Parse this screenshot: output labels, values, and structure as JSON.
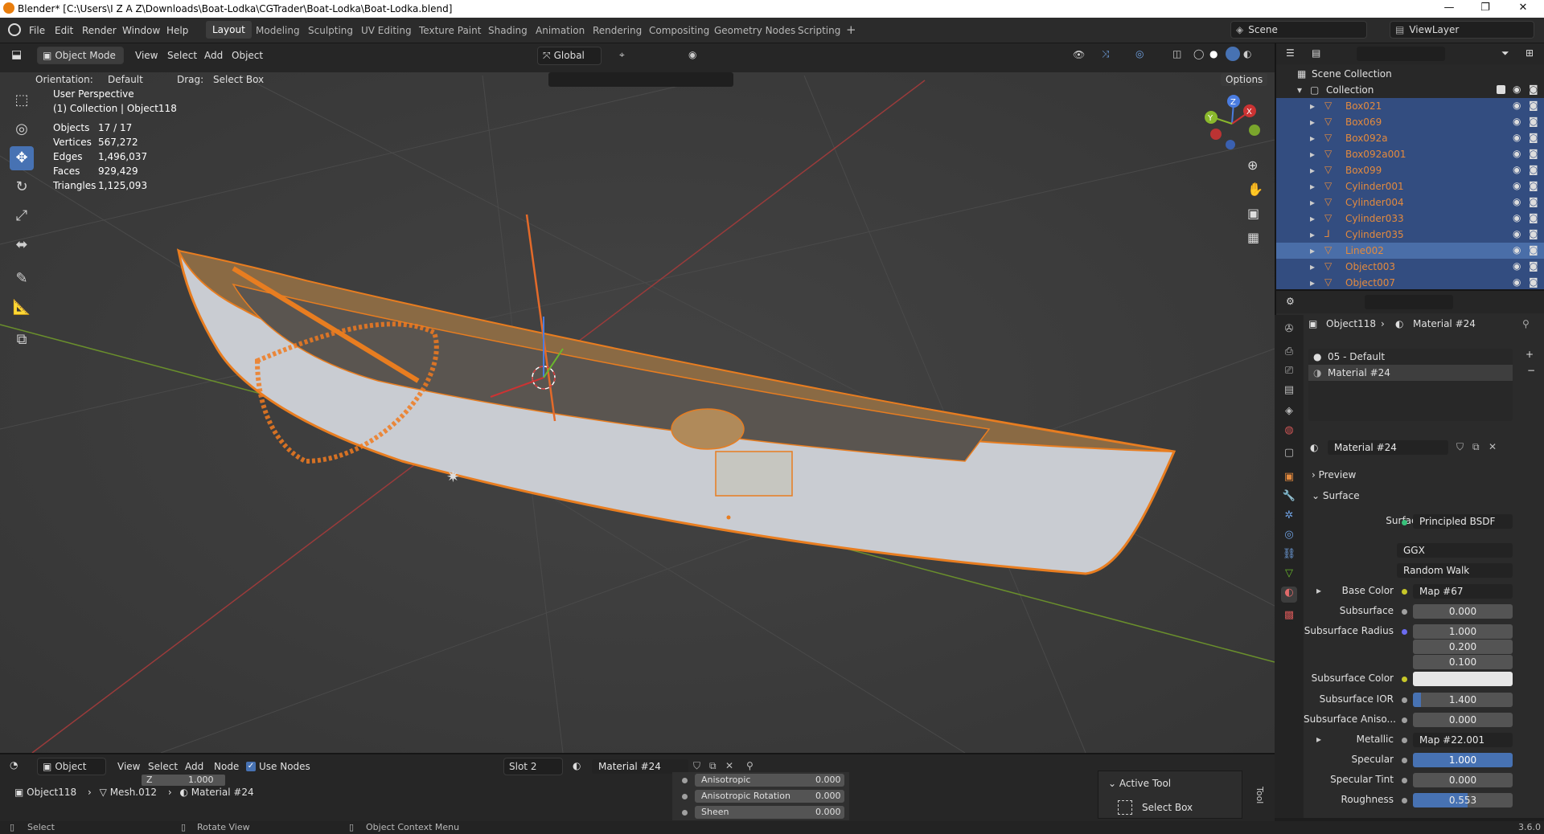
{
  "window": {
    "title": "Blender* [C:\\Users\\I Z A Z\\Downloads\\Boat-Lodka\\CGTrader\\Boat-Lodka\\Boat-Lodka.blend]",
    "minimize": "—",
    "maximize": "❐",
    "close": "✕"
  },
  "menubar": {
    "menus": [
      "File",
      "Edit",
      "Render",
      "Window",
      "Help"
    ],
    "workspaces": [
      "Layout",
      "Modeling",
      "Sculpting",
      "UV Editing",
      "Texture Paint",
      "Shading",
      "Animation",
      "Rendering",
      "Compositing",
      "Geometry Nodes",
      "Scripting"
    ],
    "add_tab": "+",
    "scene": "Scene",
    "view_layer": "ViewLayer"
  },
  "viewport_header": {
    "mode": "Object Mode",
    "menus": [
      "View",
      "Select",
      "Add",
      "Object"
    ],
    "transform_orientation": "Global",
    "orientation_label": "Orientation:",
    "orientation_value": "Default",
    "drag_label": "Drag:",
    "drag_value": "Select Box",
    "options": "Options"
  },
  "viewport": {
    "perspective": "User Perspective",
    "collection_info": "(1) Collection | Object118",
    "stats": [
      {
        "k": "Objects",
        "v": "17 / 17"
      },
      {
        "k": "Vertices",
        "v": "567,272"
      },
      {
        "k": "Edges",
        "v": "1,496,037"
      },
      {
        "k": "Faces",
        "v": "929,429"
      },
      {
        "k": "Triangles",
        "v": "1,125,093"
      }
    ],
    "gizmo": {
      "x": "X",
      "y": "Y",
      "z": "Z"
    }
  },
  "outliner": {
    "scene_collection": "Scene Collection",
    "collection": "Collection",
    "items": [
      {
        "name": "Box021"
      },
      {
        "name": "Box069"
      },
      {
        "name": "Box092a"
      },
      {
        "name": "Box092a001"
      },
      {
        "name": "Box099"
      },
      {
        "name": "Cylinder001"
      },
      {
        "name": "Cylinder004"
      },
      {
        "name": "Cylinder033"
      },
      {
        "name": "Cylinder035"
      },
      {
        "name": "Line002"
      },
      {
        "name": "Object003"
      },
      {
        "name": "Object007"
      }
    ]
  },
  "properties": {
    "breadcrumb_object": "Object118",
    "breadcrumb_material": "Material #24",
    "slots": [
      "05 - Default",
      "Material #24"
    ],
    "material_name": "Material #24",
    "preview": "Preview",
    "surface_panel": "Surface",
    "surface_label": "Surface",
    "surface_value": "Principled BSDF",
    "distribution": "GGX",
    "subsurface_method": "Random Walk",
    "rows": [
      {
        "label": "Base Color",
        "value": "Map #67"
      },
      {
        "label": "Subsurface",
        "value": "0.000"
      },
      {
        "label": "Subsurface Radius",
        "value": "1.000"
      },
      {
        "label": "",
        "value": "0.200"
      },
      {
        "label": "",
        "value": "0.100"
      },
      {
        "label": "Subsurface Color",
        "value": ""
      },
      {
        "label": "Subsurface IOR",
        "value": "1.400"
      },
      {
        "label": "Subsurface Aniso...",
        "value": "0.000"
      },
      {
        "label": "Metallic",
        "value": "Map #22.001"
      },
      {
        "label": "Specular",
        "value": "1.000"
      },
      {
        "label": "Specular Tint",
        "value": "0.000"
      },
      {
        "label": "Roughness",
        "value": "0.553"
      }
    ],
    "version": "3.6.0"
  },
  "node_editor": {
    "editor": "Object",
    "menus": [
      "View",
      "Select",
      "Add",
      "Node"
    ],
    "use_nodes": "Use Nodes",
    "slot": "Slot 2",
    "material": "Material #24",
    "breadcrumb": [
      "Object118",
      "Mesh.012",
      "Material #24"
    ],
    "z_label": "Z",
    "z_value": "1.000",
    "node_rows": [
      {
        "label": "Anisotropic",
        "value": "0.000"
      },
      {
        "label": "Anisotropic Rotation",
        "value": "0.000"
      },
      {
        "label": "Sheen",
        "value": "0.000"
      }
    ],
    "active_tool": "Active Tool",
    "select_box": "Select Box",
    "tool_tab": "Tool"
  },
  "statusbar": {
    "select": "Select",
    "rotate": "Rotate View",
    "context": "Object Context Menu"
  },
  "colors": {
    "accent": "#4772b3",
    "selection_orange": "#e38a3e",
    "viewport_bg": "#3b3b3b"
  }
}
